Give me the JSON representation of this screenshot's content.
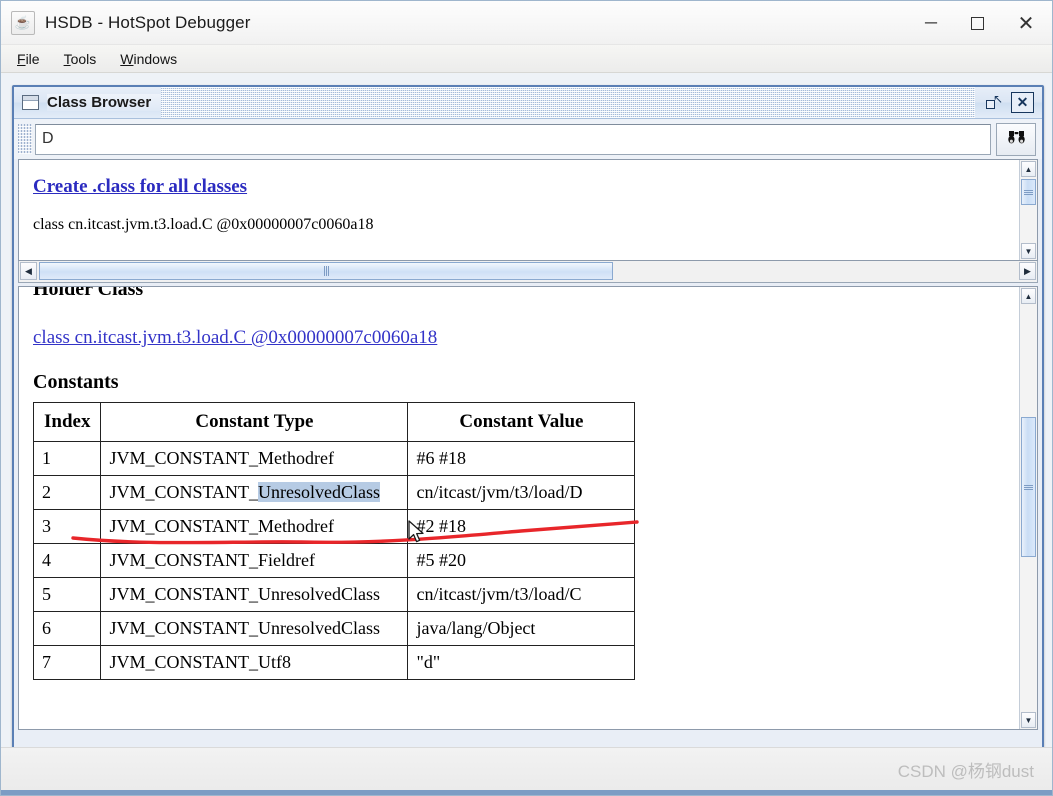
{
  "window": {
    "title": "HSDB - HotSpot Debugger",
    "app_icon": "java-coffee-cup-icon",
    "controls": {
      "minimize": "─",
      "maximize": "maximize-icon",
      "close": "✕"
    }
  },
  "menubar": {
    "items": [
      {
        "label": "File",
        "mnemonic": "F"
      },
      {
        "label": "Tools",
        "mnemonic": "T"
      },
      {
        "label": "Windows",
        "mnemonic": "W"
      }
    ]
  },
  "internal_frame": {
    "title": "Class Browser",
    "icon": "window-icon",
    "restore_label": "↖",
    "close_label": "✕"
  },
  "search": {
    "value": "D",
    "placeholder": "",
    "find_button_icon": "binoculars-icon",
    "find_button_glyph": "♟♟"
  },
  "top_pane": {
    "create_link": "Create .class for all classes",
    "class_line": "class cn.itcast.jvm.t3.load.C @0x00000007c0060a18"
  },
  "bottom_pane": {
    "holder_heading": "Holder Class",
    "holder_link": "class cn.itcast.jvm.t3.load.C @0x00000007c0060a18",
    "constants_heading": "Constants"
  },
  "constants_table": {
    "headers": [
      "Index",
      "Constant Type",
      "Constant Value"
    ],
    "rows": [
      {
        "index": "1",
        "type": "JVM_CONSTANT_Methodref",
        "type_plain": "JVM_CONSTANT_",
        "type_hl": "",
        "type_tail": "Methodref",
        "value": "#6 #18"
      },
      {
        "index": "2",
        "type": "JVM_CONSTANT_UnresolvedClass",
        "type_plain": "JVM_CONSTANT_",
        "type_hl": "UnresolvedClass",
        "type_tail": "",
        "value": "cn/itcast/jvm/t3/load/D"
      },
      {
        "index": "3",
        "type": "JVM_CONSTANT_Methodref",
        "type_plain": "JVM_CONSTANT_",
        "type_hl": "",
        "type_tail": "Methodref",
        "value": "#2 #18"
      },
      {
        "index": "4",
        "type": "JVM_CONSTANT_Fieldref",
        "type_plain": "JVM_CONSTANT_",
        "type_hl": "",
        "type_tail": "Fieldref",
        "value": "#5 #20"
      },
      {
        "index": "5",
        "type": "JVM_CONSTANT_UnresolvedClass",
        "type_plain": "JVM_CONSTANT_",
        "type_hl": "",
        "type_tail": "UnresolvedClass",
        "value": "cn/itcast/jvm/t3/load/C"
      },
      {
        "index": "6",
        "type": "JVM_CONSTANT_UnresolvedClass",
        "type_plain": "JVM_CONSTANT_",
        "type_hl": "",
        "type_tail": "UnresolvedClass",
        "value": "java/lang/Object"
      },
      {
        "index": "7",
        "type": "JVM_CONSTANT_Utf8",
        "type_plain": "JVM_CONSTANT_",
        "type_hl": "",
        "type_tail": "Utf8",
        "value": "\"d\""
      }
    ],
    "selected_text": "UnresolvedClass"
  },
  "scrollbars": {
    "up_arrow": "▲",
    "down_arrow": "▼",
    "left_arrow": "◀",
    "right_arrow": "▶"
  },
  "annotation": {
    "color": "#e8262a",
    "shape": "hand-drawn-underline"
  },
  "statusbar": {
    "watermark": "CSDN @杨钢dust"
  }
}
